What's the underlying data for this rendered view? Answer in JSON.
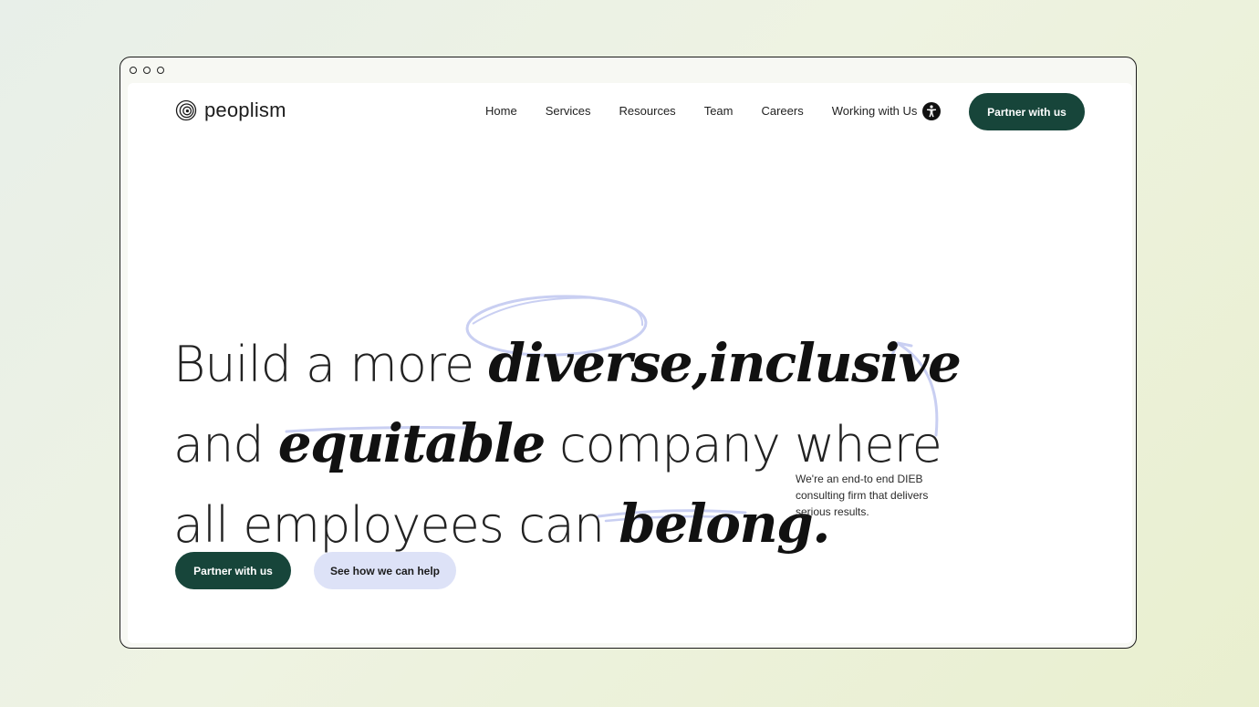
{
  "brand": {
    "name": "peoplism",
    "logo_icon": "concentric-circles-logo"
  },
  "nav": {
    "items": [
      {
        "label": "Home"
      },
      {
        "label": "Services"
      },
      {
        "label": "Resources"
      },
      {
        "label": "Team"
      },
      {
        "label": "Careers"
      },
      {
        "label": "Working with Us"
      }
    ],
    "accessibility_icon": "accessibility-icon",
    "cta_label": "Partner with us"
  },
  "hero": {
    "line1": {
      "part1": "Build a more ",
      "script1": "diverse",
      "sep": ",",
      "script2": "inclusive"
    },
    "line2": {
      "part1": "and ",
      "script1": "equitable",
      "part2": " company where"
    },
    "line3": {
      "part1": "all employees can ",
      "script1": "belong",
      "end": "."
    },
    "tagline": "We're an end-to end DIEB consulting firm that delivers serious results.",
    "primary_cta": "Partner with us",
    "secondary_cta": "See how we can help"
  },
  "colors": {
    "brand_dark": "#17453a",
    "accent_light": "#dde2f7",
    "decoration": "#c9cff2"
  }
}
